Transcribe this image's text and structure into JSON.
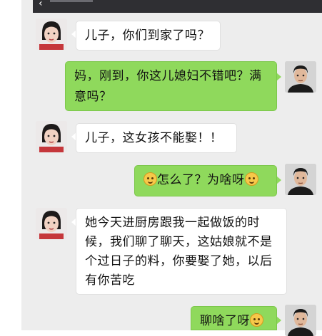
{
  "header": {
    "back_glyph": "‹"
  },
  "messages": [
    {
      "side": "left",
      "sender": "mom",
      "text": "儿子，你们到家了吗？"
    },
    {
      "side": "right",
      "sender": "son",
      "text_line1": "妈，刚到，你这儿媳妇不错吧？满",
      "text_line2": "意吗？"
    },
    {
      "side": "left",
      "sender": "mom",
      "text": "儿子，这女孩不能娶！！"
    },
    {
      "side": "right",
      "sender": "son",
      "emoji_before": "surprised-emoji",
      "text": "怎么了？为啥呀",
      "emoji_after": "smile-emoji"
    },
    {
      "side": "left",
      "sender": "mom",
      "text_line1": "她今天进厨房跟我一起做饭的时",
      "text_line2": "候，我们聊了聊天，这姑娘就不是",
      "text_line3": "个过日子的料，你要娶了她，以后",
      "text_line4": "有你苦吃"
    },
    {
      "side": "right",
      "sender": "son",
      "text": "聊啥了呀",
      "emoji_after": "smile-emoji"
    }
  ],
  "colors": {
    "chat_background": "#ededed",
    "sent_bubble": "#8fd95c",
    "received_bubble": "#ffffff",
    "top_bar": "#2f2f33"
  }
}
